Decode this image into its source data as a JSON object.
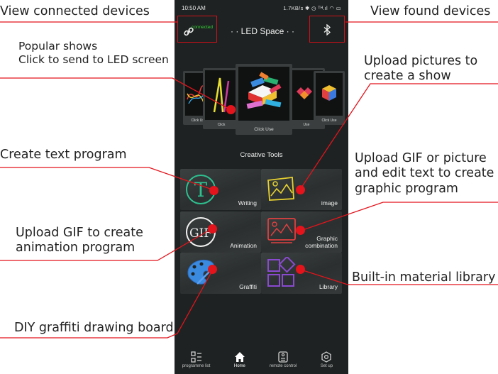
{
  "annotations": {
    "connected_devices": "View connected devices",
    "found_devices": "View found devices",
    "popular_shows": [
      "Popular shows",
      "Click to send to LED screen"
    ],
    "upload_pictures": [
      "Upload pictures to",
      "create a show"
    ],
    "create_text": "Create text program",
    "upload_gif_picture": [
      "Upload GIF or picture",
      "and edit text to create",
      "graphic program"
    ],
    "upload_gif_animation": [
      "Upload GIF to create",
      "animation program"
    ],
    "material_library": "Built-in material library",
    "graffiti_board": "DIY graffiti drawing board"
  },
  "status_bar": {
    "time": "10:50 AM",
    "right": "1.7KB/s ✱ ◷ ᵀᴴ.ıl ◠ ▭"
  },
  "header": {
    "connection_status": "connected",
    "title": "· · LED Space · ·"
  },
  "carousel": {
    "far_left_caption": "Click Use",
    "left_caption": "Click",
    "center_caption": "Click Use",
    "right_caption": "Use",
    "far_right_caption": "Click Use"
  },
  "creative_tools": {
    "section_title": "Creative Tools",
    "tiles": [
      {
        "label": "Writing",
        "icon": "text-t-icon"
      },
      {
        "label": "image",
        "icon": "image-icon"
      },
      {
        "label": "Animation",
        "icon": "gif-icon"
      },
      {
        "label": "Graphic\ncombination",
        "icon": "graphic-icon"
      },
      {
        "label": "Graffiti",
        "icon": "palette-icon"
      },
      {
        "label": "Library",
        "icon": "library-icon"
      }
    ]
  },
  "bottom_nav": [
    {
      "label": "programme list",
      "icon": "list-icon"
    },
    {
      "label": "Home",
      "icon": "home-icon"
    },
    {
      "label": "remote control",
      "icon": "remote-icon"
    },
    {
      "label": "Set up",
      "icon": "gear-icon"
    }
  ],
  "colors": {
    "phone_background": "#1e2222",
    "annotation_red": "#e3141c",
    "connected_green": "#36d236",
    "tile_background": "#353939"
  }
}
